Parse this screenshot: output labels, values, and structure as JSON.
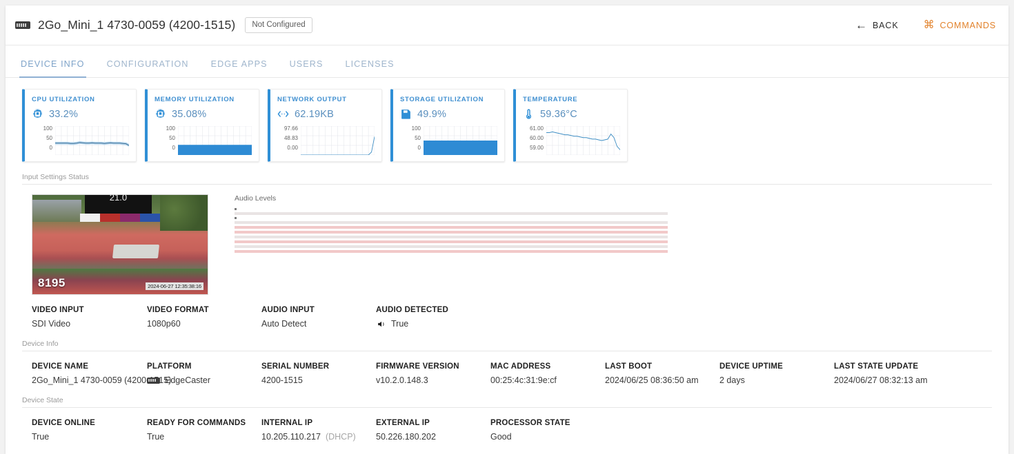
{
  "header": {
    "device_icon": "device-icon",
    "title": "2Go_Mini_1 4730-0059 (4200-1515)",
    "status_badge": "Not Configured",
    "back_label": "BACK",
    "back_icon": "arrow-left-icon",
    "commands_label": "COMMANDS",
    "commands_icon": "command-icon",
    "accent_color": "#e2822b"
  },
  "tabs": [
    {
      "label": "DEVICE INFO",
      "active": true
    },
    {
      "label": "CONFIGURATION",
      "active": false
    },
    {
      "label": "EDGE APPS",
      "active": false
    },
    {
      "label": "USERS",
      "active": false
    },
    {
      "label": "LICENSES",
      "active": false
    }
  ],
  "metric_cards": [
    {
      "title": "CPU UTILIZATION",
      "value": "33.2%",
      "icon": "cpu-chip-icon",
      "axis": [
        "100",
        "50",
        "0"
      ]
    },
    {
      "title": "MEMORY UTILIZATION",
      "value": "35.08%",
      "icon": "memory-chip-icon",
      "axis": [
        "100",
        "50",
        "0"
      ]
    },
    {
      "title": "NETWORK OUTPUT",
      "value": "62.19KB",
      "icon": "network-transfer-icon",
      "axis": [
        "97.66",
        "48.83",
        "0.00"
      ]
    },
    {
      "title": "STORAGE UTILIZATION",
      "value": "49.9%",
      "icon": "floppy-disk-icon",
      "axis": [
        "100",
        "50",
        "0"
      ]
    },
    {
      "title": "TEMPERATURE",
      "value": "59.36°C",
      "icon": "thermometer-icon",
      "axis": [
        "61.00",
        "60.00",
        "59.00"
      ]
    }
  ],
  "chart_data": [
    {
      "type": "line",
      "title": "CPU UTILIZATION",
      "ylim": [
        0,
        100
      ],
      "grid": true,
      "ylabel": "",
      "xlabel": "",
      "tick_labels": [
        "100",
        "50",
        "0"
      ],
      "values": [
        41,
        41,
        41,
        41,
        41,
        40,
        40,
        41,
        43,
        42,
        41,
        41,
        42,
        41,
        41,
        41,
        40,
        41,
        42,
        41,
        41,
        41,
        40,
        39,
        33
      ]
    },
    {
      "type": "area",
      "title": "MEMORY UTILIZATION",
      "ylim": [
        0,
        100
      ],
      "grid": true,
      "tick_labels": [
        "100",
        "50",
        "0"
      ],
      "values": [
        35,
        35,
        35,
        35,
        35,
        35,
        35,
        35,
        35,
        35,
        35,
        35,
        35,
        35,
        35,
        35,
        35,
        35,
        35,
        35,
        35,
        35,
        35,
        35,
        35
      ]
    },
    {
      "type": "line",
      "title": "NETWORK OUTPUT",
      "ylim": [
        0,
        97.66
      ],
      "grid": true,
      "tick_labels": [
        "97.66",
        "48.83",
        "0.00"
      ],
      "values": [
        0,
        0,
        0,
        0,
        0,
        0,
        0,
        0,
        0,
        0,
        0,
        0,
        0,
        0,
        0,
        0,
        0,
        0,
        0,
        0,
        0,
        0,
        0,
        10,
        62.19
      ]
    },
    {
      "type": "area",
      "title": "STORAGE UTILIZATION",
      "ylim": [
        0,
        100
      ],
      "grid": true,
      "tick_labels": [
        "100",
        "50",
        "0"
      ],
      "values": [
        49.9,
        49.9,
        49.9,
        49.9,
        49.9,
        49.9,
        49.9,
        49.9,
        49.9,
        49.9,
        49.9,
        49.9,
        49.9,
        49.9,
        49.9,
        49.9,
        49.9,
        49.9,
        49.9,
        49.9,
        49.9,
        49.9,
        49.9,
        49.9,
        49.9
      ]
    },
    {
      "type": "line",
      "title": "TEMPERATURE",
      "ylim": [
        59.0,
        61.0
      ],
      "grid": true,
      "tick_labels": [
        "61.00",
        "60.00",
        "59.00"
      ],
      "values": [
        60.55,
        60.55,
        60.6,
        60.55,
        60.5,
        60.45,
        60.4,
        60.4,
        60.35,
        60.3,
        60.3,
        60.25,
        60.2,
        60.2,
        60.15,
        60.1,
        60.1,
        60.05,
        60.0,
        60.05,
        60.1,
        60.45,
        60.2,
        59.6,
        59.36
      ]
    }
  ],
  "input_settings": {
    "section_label": "Input Settings Status",
    "audio_label": "Audio Levels",
    "video_overlay_number": "8195",
    "video_overlay_timestamp": "2024-06-27 12:35:38:16",
    "video_scoreboard": "21.0",
    "audio_channels": 8,
    "fields": [
      {
        "label": "VIDEO INPUT",
        "value": "SDI Video"
      },
      {
        "label": "VIDEO FORMAT",
        "value": "1080p60"
      },
      {
        "label": "AUDIO INPUT",
        "value": "Auto Detect"
      },
      {
        "label": "AUDIO DETECTED",
        "value": "True",
        "icon": "speaker-icon"
      }
    ]
  },
  "device_info": {
    "section_label": "Device Info",
    "fields": [
      {
        "label": "DEVICE NAME",
        "value": "2Go_Mini_1 4730-0059 (4200-1515)"
      },
      {
        "label": "PLATFORM",
        "value": "EdgeCaster",
        "icon": "platform-icon"
      },
      {
        "label": "SERIAL NUMBER",
        "value": "4200-1515"
      },
      {
        "label": "FIRMWARE VERSION",
        "value": "v10.2.0.148.3"
      },
      {
        "label": "MAC ADDRESS",
        "value": "00:25:4c:31:9e:cf"
      },
      {
        "label": "LAST BOOT",
        "value": "2024/06/25 08:36:50 am"
      },
      {
        "label": "DEVICE UPTIME",
        "value": "2 days"
      },
      {
        "label": "LAST STATE UPDATE",
        "value": "2024/06/27 08:32:13 am"
      }
    ]
  },
  "device_state": {
    "section_label": "Device State",
    "fields": [
      {
        "label": "DEVICE ONLINE",
        "value": "True"
      },
      {
        "label": "READY FOR COMMANDS",
        "value": "True"
      },
      {
        "label": "INTERNAL IP",
        "value": "10.205.110.217",
        "suffix": "(DHCP)"
      },
      {
        "label": "EXTERNAL IP",
        "value": "50.226.180.202"
      },
      {
        "label": "PROCESSOR STATE",
        "value": "Good"
      }
    ]
  }
}
